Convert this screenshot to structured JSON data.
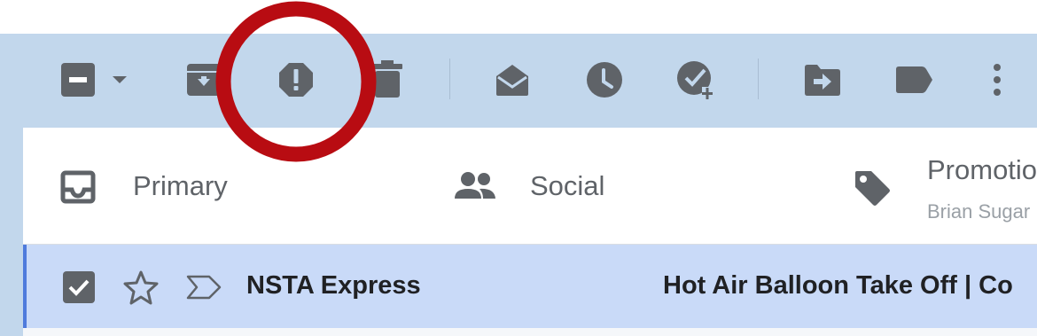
{
  "colors": {
    "toolbar_bg": "#c2d7ec",
    "icon": "#5f6368",
    "selected_row": "#c9daf8",
    "annotation_ring": "#b80c12"
  },
  "toolbar": {
    "icons": [
      "select-checkbox",
      "select-dropdown",
      "archive",
      "report-spam",
      "delete",
      "mark-as-read",
      "snooze",
      "add-to-tasks",
      "move-to",
      "labels",
      "more"
    ]
  },
  "tabs": [
    {
      "label": "Primary",
      "icon": "inbox-icon"
    },
    {
      "label": "Social",
      "icon": "people-icon"
    },
    {
      "label": "Promotions",
      "sub": "Brian Sugar",
      "icon": "tag-icon"
    }
  ],
  "email": {
    "sender": "NSTA Express",
    "subject": "Hot Air Balloon Take Off | Co",
    "selected": true,
    "starred": false
  },
  "annotation": {
    "shape": "circle",
    "target": "report-spam-button"
  }
}
